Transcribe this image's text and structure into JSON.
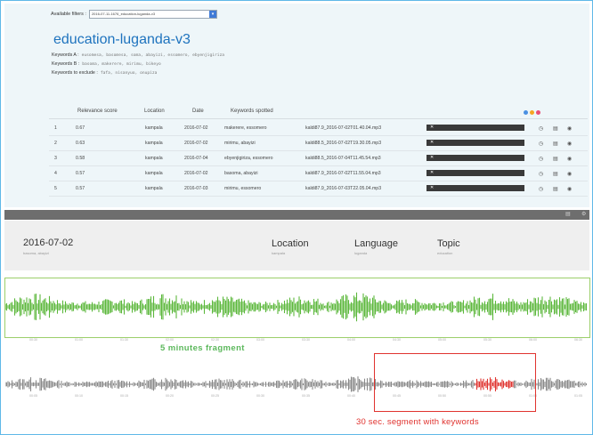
{
  "filters": {
    "label": "Available filters :",
    "selected": "2016-07-11-1676_education-luganda-v3"
  },
  "page_title": "education-luganda-v3",
  "keywords": {
    "a_label": "Keywords A :",
    "a_values": "eusomesa, basomesa, soma, abayizi, essomero, ebyenjigiriza",
    "b_label": "Keywords B :",
    "b_values": "basoma, makerere, mirimu, bikeyo",
    "exclude_label": "Keywords to exclude :",
    "exclude_values": "fafa, nisanyuo, onupiza"
  },
  "table": {
    "headers": [
      "Relevance score",
      "Location",
      "Date",
      "Keywords spotted"
    ],
    "rows": [
      {
        "idx": "1",
        "score": "0.67",
        "location": "kampala",
        "date": "2016-07-02",
        "keywords": "makerere, essomero",
        "file": "kaldi87.9_2016-07-02T01.40.04.mp3"
      },
      {
        "idx": "2",
        "score": "0.63",
        "location": "kampala",
        "date": "2016-07-02",
        "keywords": "mirimu, abayizi",
        "file": "kaldi88.5_2016-07-02T19.30.05.mp3"
      },
      {
        "idx": "3",
        "score": "0.58",
        "location": "kampala",
        "date": "2016-07-04",
        "keywords": "ebyenjigiriza, essomero",
        "file": "kaldi88.5_2016-07-04T11.45.54.mp3"
      },
      {
        "idx": "4",
        "score": "0.57",
        "location": "kampala",
        "date": "2016-07-02",
        "keywords": "basoma, abayizi",
        "file": "kaldi87.9_2016-07-02T11.55.04.mp3"
      },
      {
        "idx": "5",
        "score": "0.57",
        "location": "kampala",
        "date": "2016-07-03",
        "keywords": "mirimu, essomero",
        "file": "kaldi87.9_2016-07-03T22.05.04.mp3"
      }
    ],
    "player_close": "✕",
    "row_icons": [
      "◷",
      "▤",
      "◉"
    ]
  },
  "dot_colors": [
    "#4a90e2",
    "#f5a623",
    "#e94e77"
  ],
  "detail": {
    "date": "2016-07-02",
    "date_sub": "basoma, abayizi",
    "location_label": "Location",
    "location_value": "kampala",
    "language_label": "Language",
    "language_value": "luganda",
    "topic_label": "Topic",
    "topic_value": "education"
  },
  "ticks_1": [
    "00:30",
    "01:00",
    "01:30",
    "02:00",
    "02:30",
    "03:00",
    "03:30",
    "04:00",
    "04:30",
    "05:00",
    "05:30",
    "06:00",
    "06:30"
  ],
  "ticks_2": [
    "00:05",
    "00:10",
    "00:15",
    "00:20",
    "00:25",
    "00:30",
    "00:35",
    "00:40",
    "00:45",
    "00:50",
    "00:55",
    "01:00",
    "01:05"
  ],
  "captions": {
    "fragment": "5 minutes fragment",
    "segment": "30 sec. segment with keywords"
  },
  "colors": {
    "green_wave": "#5cb83c",
    "grey_wave": "#8a8a8a",
    "highlight": "#e0332f"
  }
}
